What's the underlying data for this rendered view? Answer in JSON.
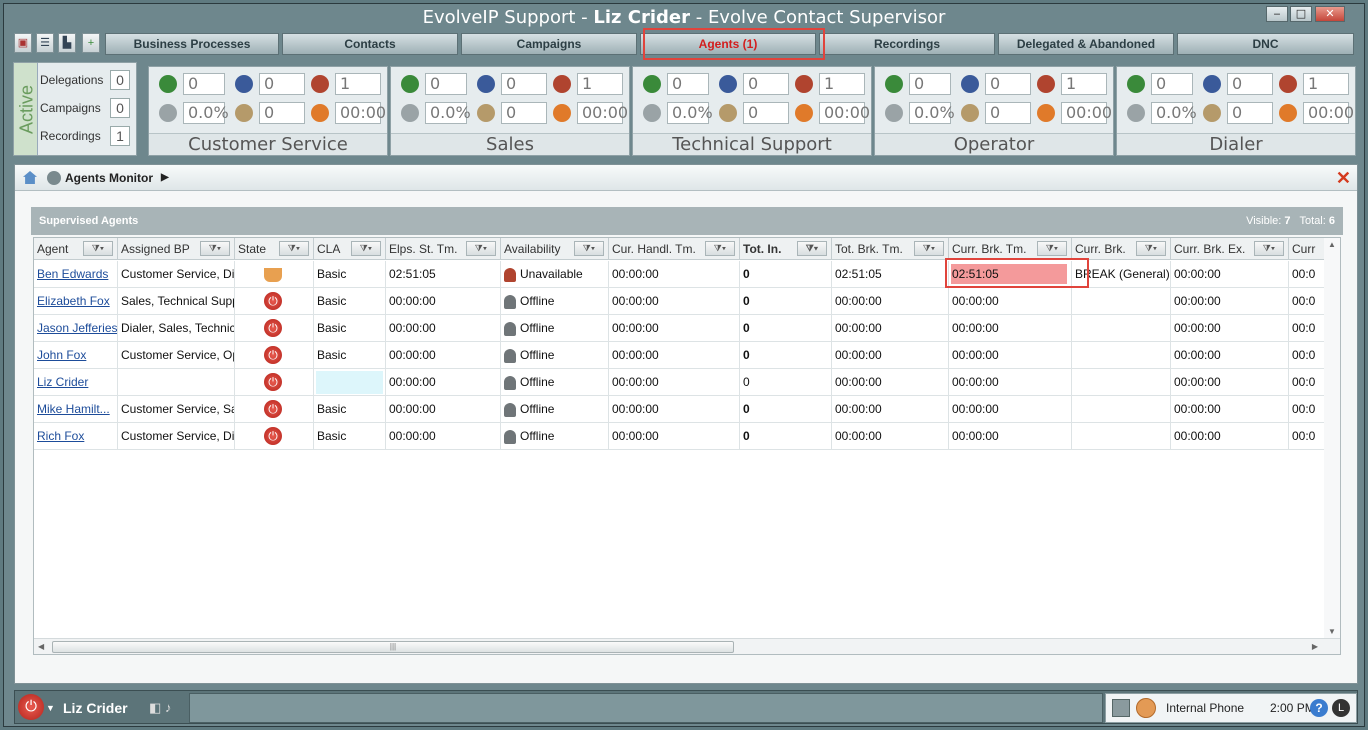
{
  "window": {
    "title_prefix": "EvolveIP Support - ",
    "title_user": "Liz Crider",
    "title_suffix": " - Evolve Contact Supervisor",
    "minimize": "‒",
    "maximize": "□",
    "close": "✕"
  },
  "tabs": [
    {
      "label": "Business Processes"
    },
    {
      "label": "Contacts"
    },
    {
      "label": "Campaigns"
    },
    {
      "label": "Agents (1)"
    },
    {
      "label": "Recordings"
    },
    {
      "label": "Delegated & Abandoned"
    },
    {
      "label": "DNC"
    }
  ],
  "active_panel": {
    "label": "Active",
    "rows": [
      {
        "label": "Delegations",
        "value": "0"
      },
      {
        "label": "Campaigns",
        "value": "0"
      },
      {
        "label": "Recordings",
        "value": "1"
      }
    ]
  },
  "queues": [
    {
      "name": "Customer Service",
      "v1": "0",
      "v2": "0",
      "v3": "1",
      "pct": "0.0%",
      "v5": "0",
      "time": "00:00"
    },
    {
      "name": "Sales",
      "v1": "0",
      "v2": "0",
      "v3": "1",
      "pct": "0.0%",
      "v5": "0",
      "time": "00:00"
    },
    {
      "name": "Technical Support",
      "v1": "0",
      "v2": "0",
      "v3": "1",
      "pct": "0.0%",
      "v5": "0",
      "time": "00:00"
    },
    {
      "name": "Operator",
      "v1": "0",
      "v2": "0",
      "v3": "1",
      "pct": "0.0%",
      "v5": "0",
      "time": "00:00"
    },
    {
      "name": "Dialer",
      "v1": "0",
      "v2": "0",
      "v3": "1",
      "pct": "0.0%",
      "v5": "0",
      "time": "00:00"
    }
  ],
  "monitor": {
    "title": "Agents Monitor",
    "section_title": "Supervised Agents",
    "visible_label": "Visible:",
    "visible_value": "7",
    "total_label": "Total:",
    "total_value": "6"
  },
  "columns": [
    "Agent",
    "Assigned BP",
    "State",
    "CLA",
    "Elps. St. Tm.",
    "Availability",
    "Cur. Handl. Tm.",
    "Tot. In.",
    "Tot. Brk. Tm.",
    "Curr. Brk. Tm.",
    "Curr. Brk.",
    "Curr. Brk. Ex.",
    "Curr"
  ],
  "rows": [
    {
      "agent": "Ben Edwards",
      "bp": "Customer Service, Di",
      "cla": "Basic",
      "elps": "02:51:05",
      "avail": "Unavailable",
      "handl": "00:00:00",
      "totin": "0",
      "totbrk": "02:51:05",
      "currbrk": "02:51:05",
      "brk": "BREAK (General)",
      "brkex": "00:00:00",
      "curr": "00:0"
    },
    {
      "agent": "Elizabeth Fox",
      "bp": "Sales, Technical Supp",
      "cla": "Basic",
      "elps": "00:00:00",
      "avail": "Offline",
      "handl": "00:00:00",
      "totin": "0",
      "totbrk": "00:00:00",
      "currbrk": "00:00:00",
      "brk": "",
      "brkex": "00:00:00",
      "curr": "00:0"
    },
    {
      "agent": "Jason Jefferies",
      "bp": "Dialer, Sales, Technic",
      "cla": "Basic",
      "elps": "00:00:00",
      "avail": "Offline",
      "handl": "00:00:00",
      "totin": "0",
      "totbrk": "00:00:00",
      "currbrk": "00:00:00",
      "brk": "",
      "brkex": "00:00:00",
      "curr": "00:0"
    },
    {
      "agent": "John Fox",
      "bp": "Customer Service, Op",
      "cla": "Basic",
      "elps": "00:00:00",
      "avail": "Offline",
      "handl": "00:00:00",
      "totin": "0",
      "totbrk": "00:00:00",
      "currbrk": "00:00:00",
      "brk": "",
      "brkex": "00:00:00",
      "curr": "00:0"
    },
    {
      "agent": "Liz Crider",
      "bp": "",
      "cla": "",
      "elps": "00:00:00",
      "avail": "Offline",
      "handl": "00:00:00",
      "totin": "0",
      "totbrk": "00:00:00",
      "currbrk": "00:00:00",
      "brk": "",
      "brkex": "00:00:00",
      "curr": "00:0"
    },
    {
      "agent": "Mike Hamilt...",
      "bp": "Customer Service, Sa",
      "cla": "Basic",
      "elps": "00:00:00",
      "avail": "Offline",
      "handl": "00:00:00",
      "totin": "0",
      "totbrk": "00:00:00",
      "currbrk": "00:00:00",
      "brk": "",
      "brkex": "00:00:00",
      "curr": "00:0"
    },
    {
      "agent": "Rich Fox",
      "bp": "Customer Service, Di",
      "cla": "Basic",
      "elps": "00:00:00",
      "avail": "Offline",
      "handl": "00:00:00",
      "totin": "0",
      "totbrk": "00:00:00",
      "currbrk": "00:00:00",
      "brk": "",
      "brkex": "00:00:00",
      "curr": "00:0"
    }
  ],
  "status": {
    "user": "Liz Crider",
    "phone": "Internal Phone",
    "time": "2:00 PM",
    "help": "?"
  },
  "colors": {
    "highlight": "#f49a9b",
    "cla_empty": "#ddf6fb",
    "callout": "#e0443c",
    "active_tab": "#d21e1e"
  }
}
